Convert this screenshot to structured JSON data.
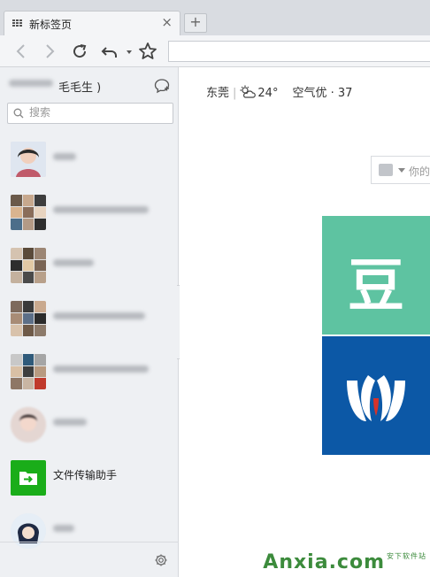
{
  "tab": {
    "title": "新标签页",
    "close": "×",
    "new_tab": "+"
  },
  "nav": {
    "back": "back-icon",
    "forward": "forward-icon",
    "reload": "reload-icon",
    "undo": "undo-icon",
    "star": "star-icon",
    "address": ""
  },
  "sidebar": {
    "user_suffix": "毛毛生 )",
    "search_placeholder": "搜索",
    "items": [
      {
        "label": "",
        "avatar": "photo"
      },
      {
        "label": "",
        "avatar": "group"
      },
      {
        "label": "",
        "avatar": "group"
      },
      {
        "label": "",
        "avatar": "group"
      },
      {
        "label": "",
        "avatar": "group"
      },
      {
        "label": "",
        "avatar": "photo"
      },
      {
        "label": "文件传输助手",
        "avatar": "file-transfer"
      },
      {
        "label": "",
        "avatar": "photo"
      }
    ]
  },
  "main": {
    "weather": {
      "city": "东莞",
      "temp": "24°",
      "aqi": "空气优 · 37"
    },
    "search_placeholder": "你的",
    "tiles": [
      {
        "name": "douban",
        "char": "豆",
        "color": "#5ec3a1"
      },
      {
        "name": "blue-logo",
        "color": "#0c58a6"
      }
    ],
    "watermark": "Anxia.com",
    "watermark_small": "安下软件站"
  },
  "colors": {
    "file_transfer": "#1aad19",
    "douban": "#5ec3a1",
    "blue_tile": "#0c58a6"
  }
}
